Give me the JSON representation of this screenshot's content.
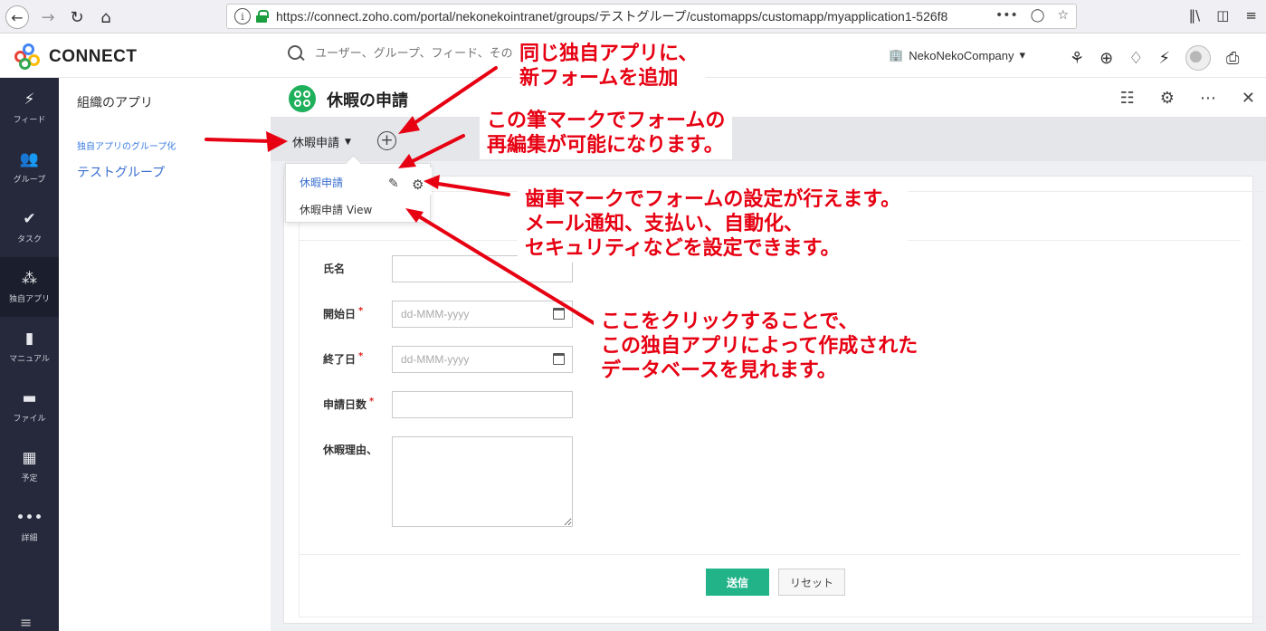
{
  "browser": {
    "url": "https://connect.zoho.com/portal/nekonekointranet/groups/テストグループ/customapps/customapp/myapplication1-526f8",
    "more": "•••"
  },
  "header": {
    "logo_text": "CONNECT",
    "search_placeholder": "ユーザー、グループ、フィード、その他",
    "company": "NekoNekoCompany",
    "company_caret": "▾"
  },
  "sidebar": {
    "items": [
      {
        "label": "フィード",
        "icon": "⚡"
      },
      {
        "label": "グループ",
        "icon": "👥"
      },
      {
        "label": "タスク",
        "icon": "✔"
      },
      {
        "label": "独自アプリ",
        "icon": "⁂"
      },
      {
        "label": "マニュアル",
        "icon": "▮"
      },
      {
        "label": "ファイル",
        "icon": "▬"
      },
      {
        "label": "予定",
        "icon": "▦"
      },
      {
        "label": "詳細",
        "icon": "•••"
      }
    ]
  },
  "org_panel": {
    "title": "組織のアプリ",
    "group_label": "独自アプリのグループ化",
    "group_item": "テストグループ"
  },
  "app": {
    "title": "休暇の申請",
    "form_tab": "休暇申請",
    "dropdown": {
      "items": [
        "休暇申請",
        "休暇申請 View"
      ]
    }
  },
  "form": {
    "fields": [
      {
        "label": "氏名",
        "required": false,
        "type": "text",
        "placeholder": ""
      },
      {
        "label": "開始日",
        "required": true,
        "type": "date",
        "placeholder": "dd-MMM-yyyy"
      },
      {
        "label": "終了日",
        "required": true,
        "type": "date",
        "placeholder": "dd-MMM-yyyy"
      },
      {
        "label": "申請日数",
        "required": true,
        "type": "text",
        "placeholder": ""
      },
      {
        "label": "休暇理由、",
        "required": false,
        "type": "textarea",
        "placeholder": ""
      }
    ],
    "required_mark": "*",
    "submit_label": "送信",
    "reset_label": "リセット"
  },
  "annotations": {
    "note1": [
      "同じ独自アプリに、",
      "新フォームを追加"
    ],
    "note2": [
      "この筆マークでフォームの",
      "再編集が可能になります。"
    ],
    "note3": [
      "歯車マークでフォームの設定が行えます。",
      "メール通知、支払い、自動化、",
      "セキュリティなどを設定できます。"
    ],
    "note4": [
      "ここをクリックすることで、",
      "この独自アプリによって作成された",
      "データベースを見れます。"
    ],
    "color": "#e60012"
  }
}
